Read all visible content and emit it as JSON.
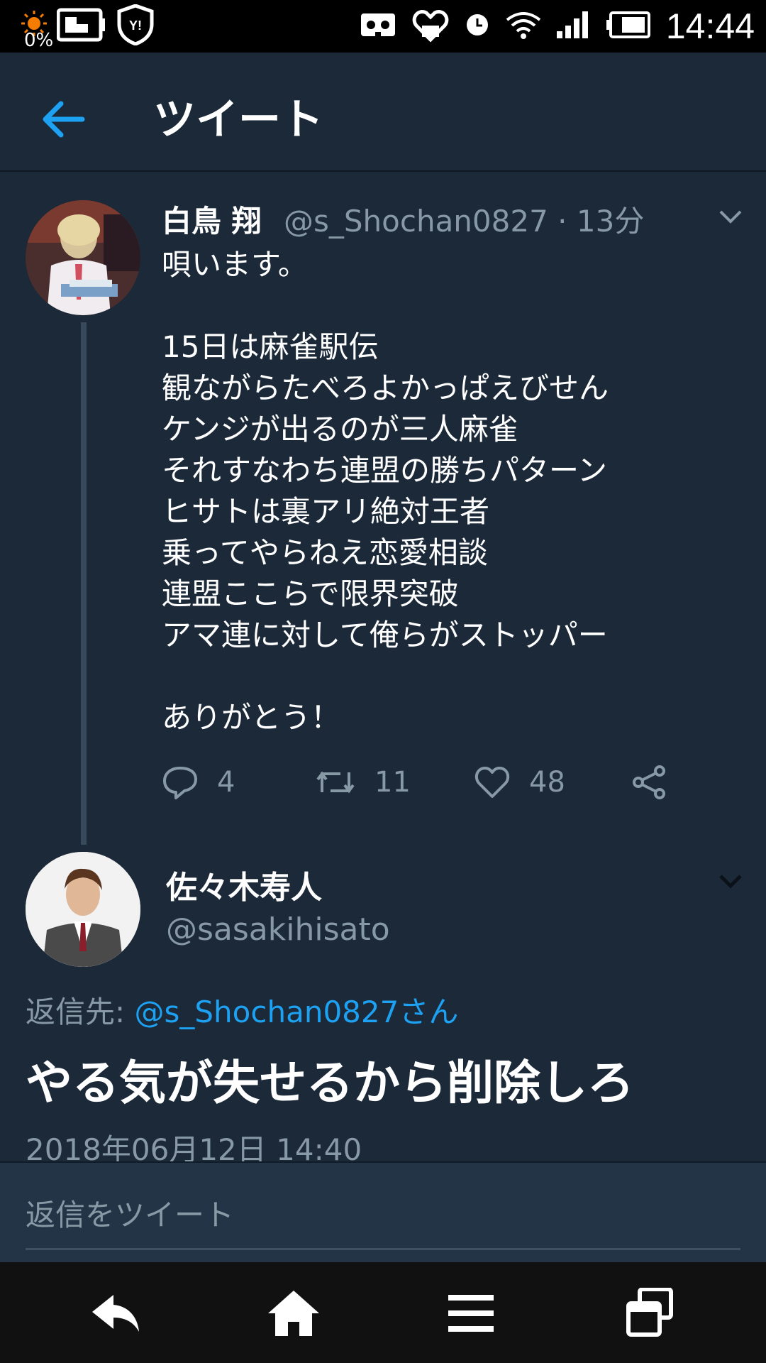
{
  "status_bar": {
    "battery_percent_label": "0%",
    "time": "14:44",
    "icons": [
      "brightness-icon",
      "smart-remote-icon",
      "yahoo-shield-icon",
      "vr-icon",
      "health-heart-icon",
      "alarm-icon",
      "wifi-icon",
      "signal-icon",
      "battery-icon"
    ]
  },
  "header": {
    "title": "ツイート",
    "back_icon": "back-arrow-icon"
  },
  "parent_tweet": {
    "display_name": "白鳥 翔",
    "handle": "@s_Shochan0827",
    "separator": "·",
    "age": "13分",
    "lines": [
      "唄います。",
      "",
      "15日は麻雀駅伝",
      "観ながらたべろよかっぱえびせん",
      "ケンジが出るのが三人麻雀",
      "それすなわち連盟の勝ちパターン",
      "ヒサトは裏アリ絶対王者",
      "乗ってやらねえ恋愛相談",
      "連盟ここらで限界突破",
      "アマ連に対して俺らがストッパー",
      "",
      "ありがとう！"
    ],
    "reply_count": "4",
    "retweet_count": "11",
    "like_count": "48"
  },
  "reply_tweet": {
    "display_name": "佐々木寿人",
    "handle": "@sasakihisato",
    "replying_to_label": "返信先:",
    "replying_to_mention": "@s_Shochan0827さん",
    "text": "やる気が失せるから削除しろ",
    "timestamp": "2018年06月12日 14:40"
  },
  "compose": {
    "placeholder": "返信をツイート"
  },
  "colors": {
    "background": "#1c2938",
    "accent": "#1da1f2",
    "secondary_text": "#8899a6"
  }
}
